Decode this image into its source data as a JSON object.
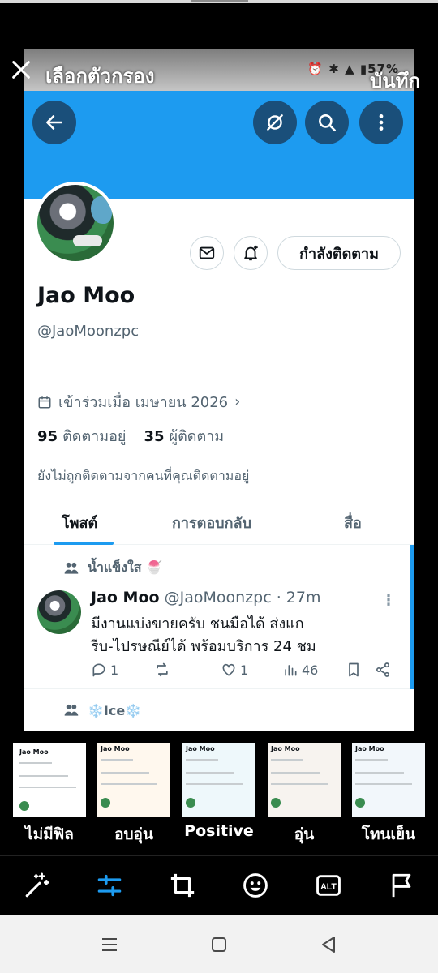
{
  "editor": {
    "title": "เลือกตัวกรอง",
    "save_label": "บันทึก",
    "close_icon": "close-icon",
    "filters": [
      {
        "label": "ไม่มีฟิล",
        "selected": true
      },
      {
        "label": "อบอุ่น",
        "selected": false
      },
      {
        "label": "Positive",
        "selected": false
      },
      {
        "label": "อุ่น",
        "selected": false
      },
      {
        "label": "โทนเย็น",
        "selected": false
      }
    ],
    "thumb_name": "Jao Moo",
    "tools": [
      "magic-wand-icon",
      "adjust-sliders-icon",
      "crop-icon",
      "sticker-face-icon",
      "alt-text-icon",
      "flag-icon"
    ],
    "tool_alt_label": "ALT",
    "accent": "#1d9bf0"
  },
  "preview": {
    "status_time": "",
    "status_battery": "57%",
    "profile": {
      "name": "Jao Moo",
      "handle": "@JaoMoonzpc",
      "follow_button": "กำลังติดตาม",
      "joined": "เข้าร่วมเมื่อ เมษายน 2026",
      "following_count": "95",
      "following_label": "ติดตามอยู่",
      "followers_count": "35",
      "followers_label": "ผู้ติดตาม",
      "notice": "ยังไม่ถูกติดตามจากคนที่คุณติดตามอยู่"
    },
    "tabs": [
      "โพสต์",
      "การตอบกลับ",
      "สื่อ"
    ],
    "posts": [
      {
        "community": "น้ำแข็งใส 🍧",
        "author": "Jao Moo",
        "meta": "@JaoMoonzpc · 27m",
        "text_line1": "มีงานแบ่งขายครับ ชนมือได้  ส่งแก",
        "text_line2": "รีบ-ไปรษณีย์ได้ พร้อมบริการ 24 ชม",
        "replies": "1",
        "likes": "1",
        "views": "46"
      },
      {
        "community": "❄️Ice❄️"
      }
    ]
  }
}
